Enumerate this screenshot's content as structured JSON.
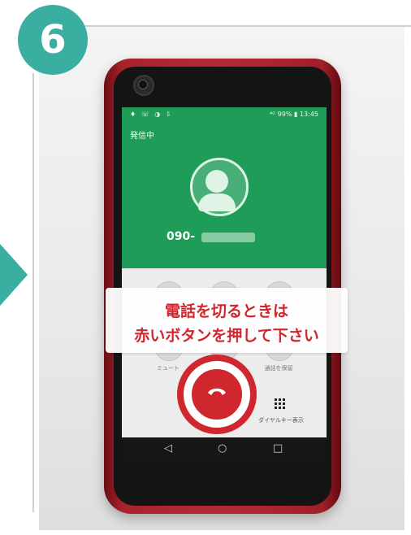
{
  "step": {
    "number": "6"
  },
  "status_bar": {
    "left": "♦ ☏ ◑ ⇩",
    "right": "⁴ᴳ 99% ▮ 13:45"
  },
  "call": {
    "status": "発信中",
    "number_prefix": "090-",
    "controls": [
      {
        "label": "ミュート"
      },
      {
        "label": ""
      },
      {
        "label": "通話を保留"
      }
    ],
    "keypad_label": "ダイヤルキー表示"
  },
  "callout": {
    "line1": "電話を切るときは",
    "line2": "赤いボタンを押して下さい"
  },
  "nav": {
    "back": "◁",
    "home": "○",
    "recent": "□"
  },
  "colors": {
    "teal": "#3aaea1",
    "green": "#1f9d58",
    "red": "#d0262d",
    "phone_body": "#b52a32"
  }
}
